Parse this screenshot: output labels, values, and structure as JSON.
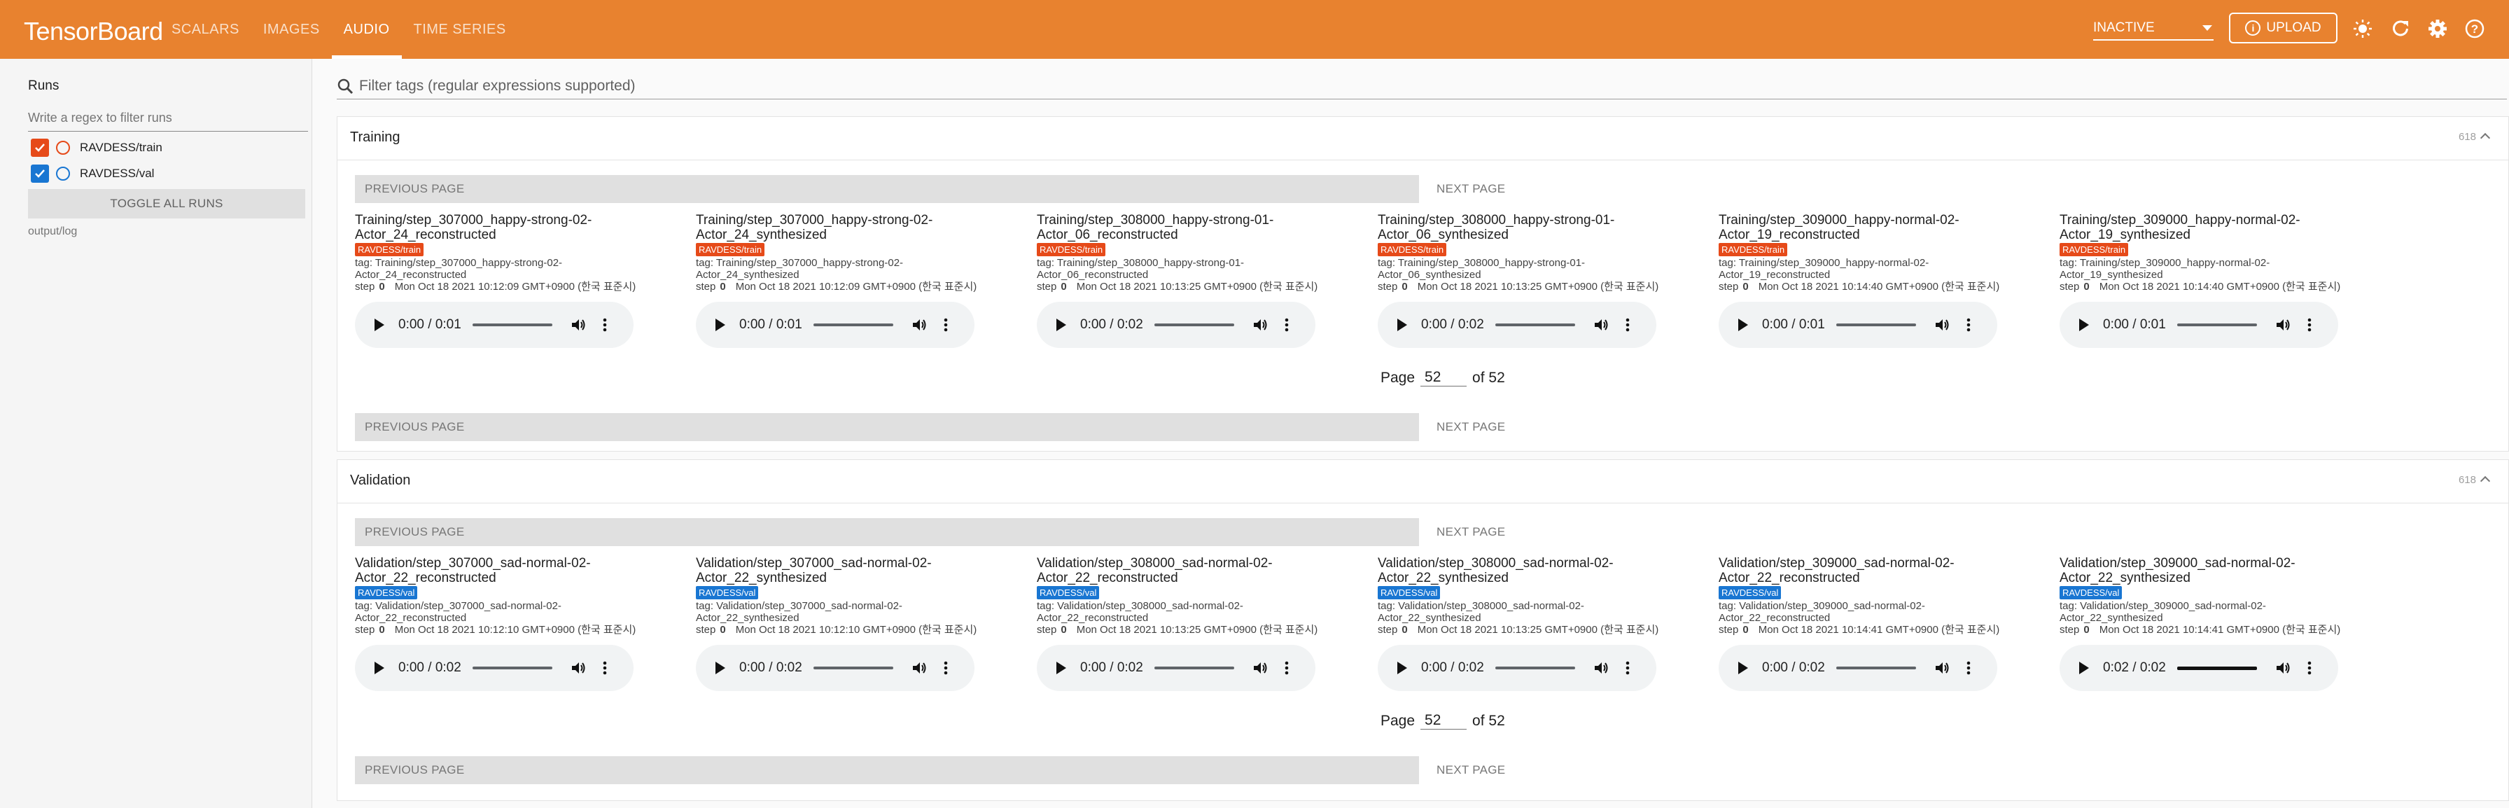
{
  "app": {
    "title": "TensorBoard",
    "nav_tabs": [
      {
        "label": "SCALARS",
        "active": false
      },
      {
        "label": "IMAGES",
        "active": false
      },
      {
        "label": "AUDIO",
        "active": true
      },
      {
        "label": "TIME SERIES",
        "active": false
      }
    ],
    "run_select_value": "INACTIVE",
    "upload_label": "UPLOAD",
    "colors": {
      "header": "#e8822f",
      "train": "#e64a19",
      "val": "#1976d2"
    }
  },
  "sidebar": {
    "title": "Runs",
    "filter_placeholder": "Write a regex to filter runs",
    "runs": [
      {
        "label": "RAVDESS/train",
        "checked": true,
        "color": "#e64a19"
      },
      {
        "label": "RAVDESS/val",
        "checked": true,
        "color": "#1976d2"
      }
    ],
    "toggle_label": "TOGGLE ALL RUNS",
    "log_dir": "output/log"
  },
  "search": {
    "placeholder": "Filter tags (regular expressions supported)"
  },
  "pagination": {
    "previous": "PREVIOUS PAGE",
    "next": "NEXT PAGE",
    "page_word": "Page",
    "of_word": "of 52",
    "current": "52"
  },
  "sections": [
    {
      "title": "Training",
      "count": "618",
      "cards": [
        {
          "title": "Training/step_307000_happy-strong-02-Actor_24_reconstructed",
          "run": "RAVDESS/train",
          "tag": "tag: Training/step_307000_happy-strong-02-Actor_24_reconstructed",
          "step_label": "step",
          "step": "0",
          "time": "Mon Oct 18 2021 10:12:09 GMT+0900 (한국 표준시)",
          "player_time": "0:00 / 0:01"
        },
        {
          "title": "Training/step_307000_happy-strong-02-Actor_24_synthesized",
          "run": "RAVDESS/train",
          "tag": "tag: Training/step_307000_happy-strong-02-Actor_24_synthesized",
          "step_label": "step",
          "step": "0",
          "time": "Mon Oct 18 2021 10:12:09 GMT+0900 (한국 표준시)",
          "player_time": "0:00 / 0:01"
        },
        {
          "title": "Training/step_308000_happy-strong-01-Actor_06_reconstructed",
          "run": "RAVDESS/train",
          "tag": "tag: Training/step_308000_happy-strong-01-Actor_06_reconstructed",
          "step_label": "step",
          "step": "0",
          "time": "Mon Oct 18 2021 10:13:25 GMT+0900 (한국 표준시)",
          "player_time": "0:00 / 0:02"
        },
        {
          "title": "Training/step_308000_happy-strong-01-Actor_06_synthesized",
          "run": "RAVDESS/train",
          "tag": "tag: Training/step_308000_happy-strong-01-Actor_06_synthesized",
          "step_label": "step",
          "step": "0",
          "time": "Mon Oct 18 2021 10:13:25 GMT+0900 (한국 표준시)",
          "player_time": "0:00 / 0:02"
        },
        {
          "title": "Training/step_309000_happy-normal-02-Actor_19_reconstructed",
          "run": "RAVDESS/train",
          "tag": "tag: Training/step_309000_happy-normal-02-Actor_19_reconstructed",
          "step_label": "step",
          "step": "0",
          "time": "Mon Oct 18 2021 10:14:40 GMT+0900 (한국 표준시)",
          "player_time": "0:00 / 0:01"
        },
        {
          "title": "Training/step_309000_happy-normal-02-Actor_19_synthesized",
          "run": "RAVDESS/train",
          "tag": "tag: Training/step_309000_happy-normal-02-Actor_19_synthesized",
          "step_label": "step",
          "step": "0",
          "time": "Mon Oct 18 2021 10:14:40 GMT+0900 (한국 표준시)",
          "player_time": "0:00 / 0:01"
        }
      ]
    },
    {
      "title": "Validation",
      "count": "618",
      "cards": [
        {
          "title": "Validation/step_307000_sad-normal-02-Actor_22_reconstructed",
          "run": "RAVDESS/val",
          "tag": "tag: Validation/step_307000_sad-normal-02-Actor_22_reconstructed",
          "step_label": "step",
          "step": "0",
          "time": "Mon Oct 18 2021 10:12:10 GMT+0900 (한국 표준시)",
          "player_time": "0:00 / 0:02"
        },
        {
          "title": "Validation/step_307000_sad-normal-02-Actor_22_synthesized",
          "run": "RAVDESS/val",
          "tag": "tag: Validation/step_307000_sad-normal-02-Actor_22_synthesized",
          "step_label": "step",
          "step": "0",
          "time": "Mon Oct 18 2021 10:12:10 GMT+0900 (한국 표준시)",
          "player_time": "0:00 / 0:02"
        },
        {
          "title": "Validation/step_308000_sad-normal-02-Actor_22_reconstructed",
          "run": "RAVDESS/val",
          "tag": "tag: Validation/step_308000_sad-normal-02-Actor_22_reconstructed",
          "step_label": "step",
          "step": "0",
          "time": "Mon Oct 18 2021 10:13:25 GMT+0900 (한국 표준시)",
          "player_time": "0:00 / 0:02"
        },
        {
          "title": "Validation/step_308000_sad-normal-02-Actor_22_synthesized",
          "run": "RAVDESS/val",
          "tag": "tag: Validation/step_308000_sad-normal-02-Actor_22_synthesized",
          "step_label": "step",
          "step": "0",
          "time": "Mon Oct 18 2021 10:13:25 GMT+0900 (한국 표준시)",
          "player_time": "0:00 / 0:02"
        },
        {
          "title": "Validation/step_309000_sad-normal-02-Actor_22_reconstructed",
          "run": "RAVDESS/val",
          "tag": "tag: Validation/step_309000_sad-normal-02-Actor_22_reconstructed",
          "step_label": "step",
          "step": "0",
          "time": "Mon Oct 18 2021 10:14:41 GMT+0900 (한국 표준시)",
          "player_time": "0:00 / 0:02"
        },
        {
          "title": "Validation/step_309000_sad-normal-02-Actor_22_synthesized",
          "run": "RAVDESS/val",
          "tag": "tag: Validation/step_309000_sad-normal-02-Actor_22_synthesized",
          "step_label": "step",
          "step": "0",
          "time": "Mon Oct 18 2021 10:14:41 GMT+0900 (한국 표준시)",
          "player_time": "0:02 / 0:02"
        }
      ]
    }
  ]
}
